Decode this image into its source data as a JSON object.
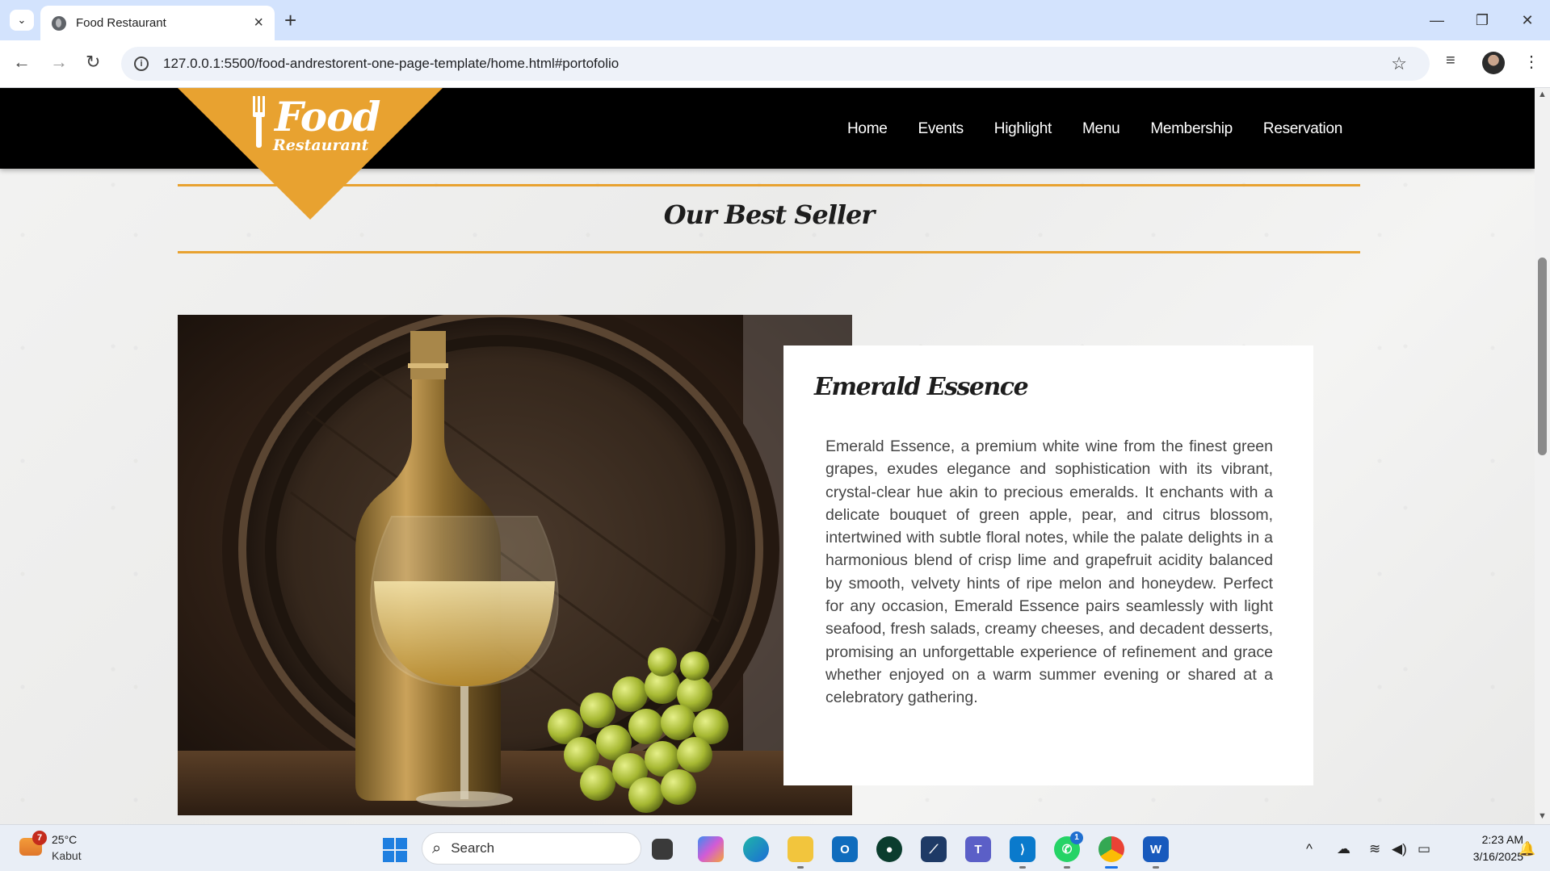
{
  "browser": {
    "tab_title": "Food Restaurant",
    "url": "127.0.0.1:5500/food-andrestorent-one-page-template/home.html#portofolio"
  },
  "site": {
    "logo": {
      "food": "Food",
      "restaurant": "Restaurant"
    },
    "nav": [
      "Home",
      "Events",
      "Highlight",
      "Menu",
      "Membership",
      "Reservation"
    ],
    "section_title": "Our Best Seller",
    "feature": {
      "title": "Emerald Essence",
      "description": "Emerald Essence, a premium white wine from the finest green grapes, exudes elegance and sophistication with its vibrant, crystal-clear hue akin to precious emeralds. It enchants with a delicate bouquet of green apple, pear, and citrus blossom, intertwined with subtle floral notes, while the palate delights in a harmonious blend of crisp lime and grapefruit acidity balanced by smooth, velvety hints of ripe melon and honeydew. Perfect for any occasion, Emerald Essence pairs seamlessly with light seafood, fresh salads, creamy cheeses, and decadent desserts, promising an unforgettable experience of refinement and grace whether enjoyed on a warm summer evening or shared at a celebratory gathering."
    }
  },
  "taskbar": {
    "weather": {
      "temp": "25°C",
      "condition": "Kabut",
      "badge": "7"
    },
    "search_placeholder": "Search",
    "whatsapp_badge": "1",
    "time": "2:23 AM",
    "date": "3/16/2025"
  },
  "colors": {
    "accent": "#e8a230",
    "header": "#000000",
    "tabstrip": "#d3e3fd"
  }
}
